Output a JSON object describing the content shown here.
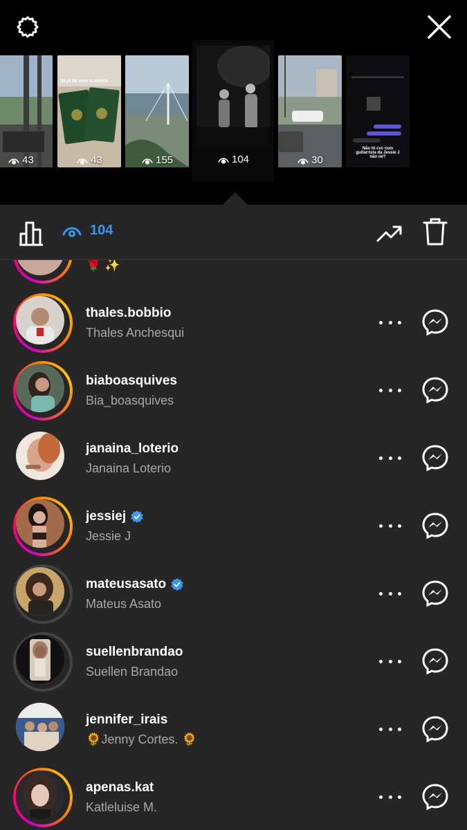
{
  "header": {
    "settings_icon": "gear-icon",
    "close_icon": "close-icon"
  },
  "stories": [
    {
      "views": "43"
    },
    {
      "views": "43"
    },
    {
      "views": "155"
    },
    {
      "views": "104",
      "active": true
    },
    {
      "views": "30"
    },
    {
      "views": ""
    }
  ],
  "thumb_texts": {
    "story2_caption": "Já já tô com a minha",
    "story6_caption": "Não tô cvc com guitarrista da Jessie J não né?"
  },
  "toolbar": {
    "view_count": "104",
    "accent_color": "#3897f0"
  },
  "partial_row": {
    "fullname": "🌹 ✨"
  },
  "viewers": [
    {
      "username": "thales.bobbio",
      "fullname": "Thales Anchesqui",
      "verified": false,
      "ring": "gradient"
    },
    {
      "username": "biaboasquives",
      "fullname": "Bia_boasquives",
      "verified": false,
      "ring": "gradient"
    },
    {
      "username": "janaina_loterio",
      "fullname": "Janaina Loterio",
      "verified": false,
      "ring": "none"
    },
    {
      "username": "jessiej",
      "fullname": "Jessie J",
      "verified": true,
      "ring": "gradient"
    },
    {
      "username": "mateusasato",
      "fullname": "Mateus Asato",
      "verified": true,
      "ring": "grey"
    },
    {
      "username": "suellenbrandao",
      "fullname": "Suellen Brandao",
      "verified": false,
      "ring": "grey"
    },
    {
      "username": "jennifer_irais",
      "fullname": "🌻Jenny Cortes. 🌻",
      "verified": false,
      "ring": "none"
    },
    {
      "username": "apenas.kat",
      "fullname": "Katleluise M.",
      "verified": false,
      "ring": "gradient"
    }
  ]
}
